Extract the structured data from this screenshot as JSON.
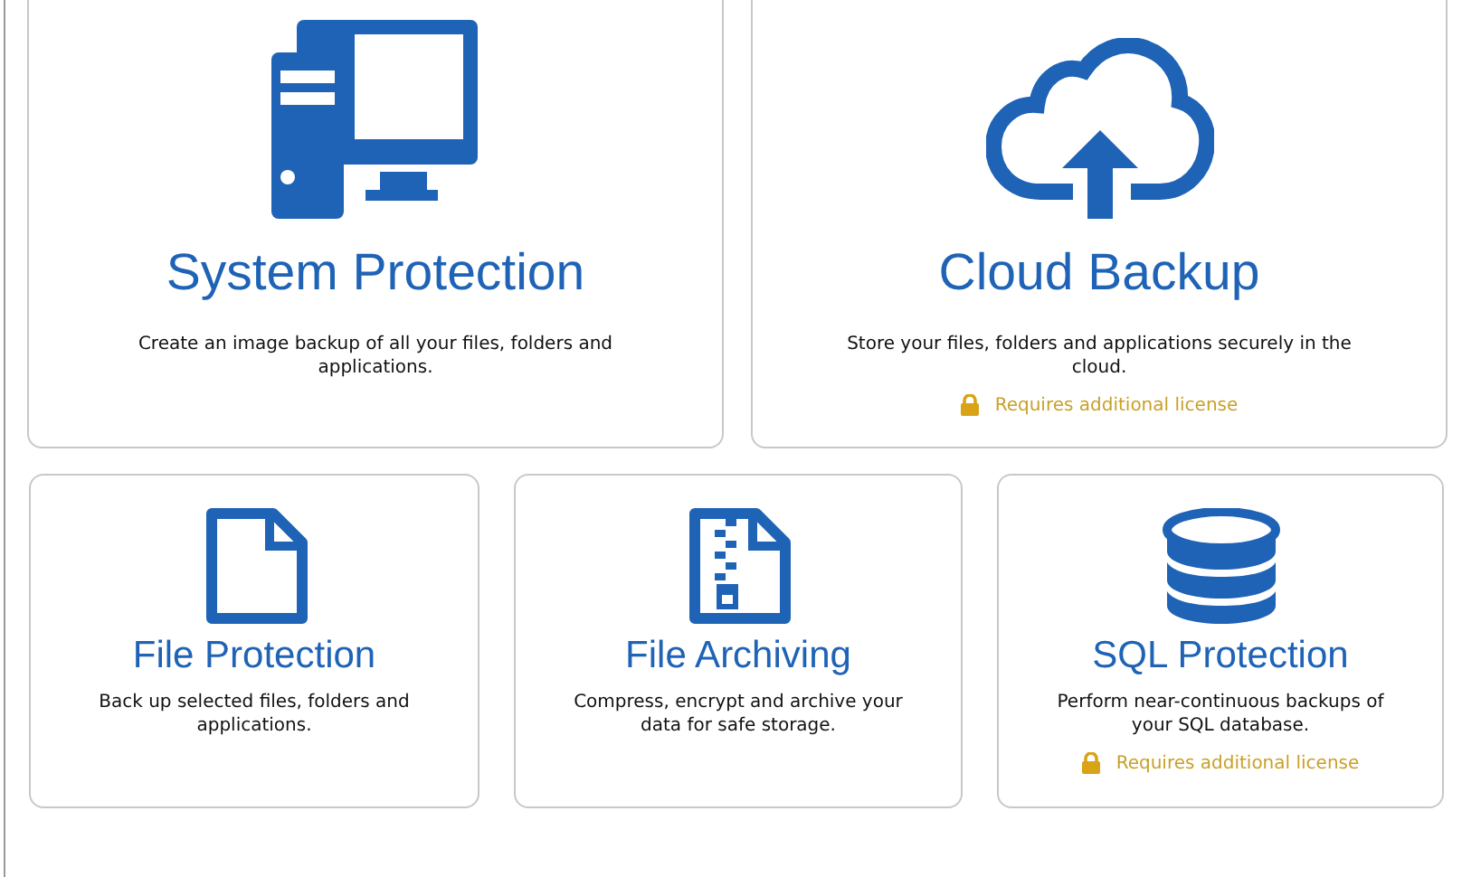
{
  "top_row": [
    {
      "kind": "computer",
      "title": "System Protection",
      "description": "Create an image backup of all your files, folders and applications."
    },
    {
      "kind": "cloud",
      "title": "Cloud Backup",
      "description": "Store your files, folders and applications securely in the cloud.",
      "notice": "Requires additional license"
    }
  ],
  "bottom_row": [
    {
      "kind": "file",
      "title": "File Protection",
      "description": "Back up selected files, folders and applications."
    },
    {
      "kind": "archive",
      "title": "File Archiving",
      "description": "Compress, encrypt and archive your data for safe storage."
    },
    {
      "kind": "database",
      "title": "SQL Protection",
      "description": "Perform near-continuous backups of your SQL database.",
      "notice": "Requires additional license"
    }
  ]
}
